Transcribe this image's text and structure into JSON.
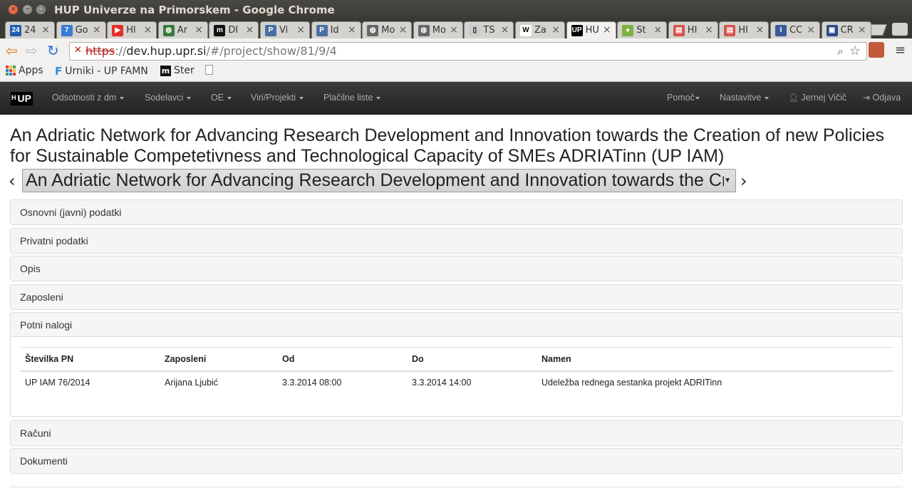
{
  "window": {
    "title": "HUP Univerze na Primorskem - Google Chrome"
  },
  "tabs": [
    {
      "label": "24",
      "icon": "24ur-icon",
      "color": "#1f5fb0",
      "glyph": "24"
    },
    {
      "label": "Go",
      "icon": "google-calendar-icon",
      "color": "#3a7bd5",
      "glyph": "7"
    },
    {
      "label": "Hl",
      "icon": "youtube-icon",
      "color": "#e52d27",
      "glyph": "▶"
    },
    {
      "label": "Ar",
      "icon": "globe-icon",
      "color": "#3a7a3a",
      "glyph": "◍"
    },
    {
      "label": "DI",
      "icon": "moodle-icon",
      "color": "#111",
      "glyph": "m"
    },
    {
      "label": "Vi",
      "icon": "p-icon",
      "color": "#4a6fa5",
      "glyph": "P"
    },
    {
      "label": "Id",
      "icon": "p-icon",
      "color": "#4a6fa5",
      "glyph": "P"
    },
    {
      "label": "Mo",
      "icon": "globe-icon",
      "color": "#666",
      "glyph": "◍"
    },
    {
      "label": "Mo",
      "icon": "globe-icon",
      "color": "#666",
      "glyph": "◍"
    },
    {
      "label": "TS",
      "icon": "page-icon",
      "color": "#ccc",
      "glyph": "▯"
    },
    {
      "label": "Za",
      "icon": "wikipedia-icon",
      "color": "#fff",
      "glyph": "W"
    },
    {
      "label": "HU",
      "icon": "hup-icon",
      "color": "#000",
      "glyph": "UP"
    },
    {
      "label": "Št",
      "icon": "tennis-icon",
      "color": "#7cb342",
      "glyph": "●"
    },
    {
      "label": "HI",
      "icon": "page-icon",
      "color": "#d9534f",
      "glyph": "▤"
    },
    {
      "label": "HI",
      "icon": "page-icon",
      "color": "#d9534f",
      "glyph": "▤"
    },
    {
      "label": "CC",
      "icon": "iam-icon",
      "color": "#3a5a9a",
      "glyph": "I"
    },
    {
      "label": "CR",
      "icon": "cr-icon",
      "color": "#2a4a8a",
      "glyph": "▣"
    }
  ],
  "toolbar": {
    "url_scheme": "https",
    "url_sep": "://",
    "url_host": "dev.hup.upr.si",
    "url_path": "/#/project/show/81/9/4"
  },
  "bookmarks": [
    {
      "label": "Apps",
      "icon": "apps-grid-icon"
    },
    {
      "label": "Urniki - UP FAMNI",
      "icon": "f-icon"
    },
    {
      "label": "Ster",
      "icon": "moodle-icon"
    },
    {
      "label": "",
      "icon": "page-icon"
    }
  ],
  "navbar": {
    "brand": "UP",
    "brand_small": "H",
    "left": [
      "Odsotnosti z dm",
      "Sodelavci",
      "OE",
      "Viri/Projekti",
      "Plačilne liste"
    ],
    "help": "Pomoč",
    "settings": "Nastavitve",
    "user": "Jernej Vičič",
    "logout": "Odjava"
  },
  "page": {
    "title": "An Adriatic Network for Advancing Research Development and Innovation towards the Creation of new Policies for Sustainable Competetivness and Technological Capacity of SMEs ADRIATinn (UP IAM)",
    "selected_project": "An Adriatic Network for Advancing Research Development and Innovation towards the Creation of new Policies for Sustainable Competetivness and Technological Capacity of SMEs ADRIATinn (UP IAM)"
  },
  "panels": {
    "osnovni": "Osnovni (javni) podatki",
    "privatni": "Privatni podatki",
    "opis": "Opis",
    "zaposleni": "Zaposleni",
    "potni": "Potni nalogi",
    "racuni": "Računi",
    "dokumenti": "Dokumenti"
  },
  "travel_orders": {
    "headers": [
      "Številka PN",
      "Zaposleni",
      "Od",
      "Do",
      "Namen"
    ],
    "rows": [
      [
        "UP IAM 76/2014",
        "Arijana Ljubić",
        "3.3.2014 08:00",
        "3.3.2014 14:00",
        "Udeležba rednega sestanka projekt ADRITinn"
      ]
    ]
  }
}
